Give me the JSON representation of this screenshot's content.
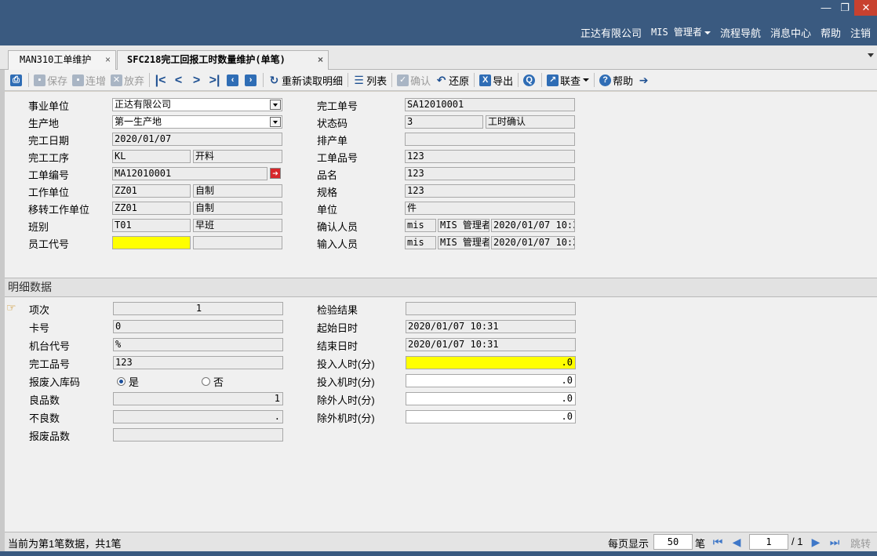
{
  "window": {
    "minimize": "—",
    "restore": "❐",
    "close": "✕"
  },
  "top_menu": {
    "company": "正达有限公司",
    "user": "MIS 管理者",
    "flow_nav": "流程导航",
    "message_center": "消息中心",
    "help": "帮助",
    "logout": "注销"
  },
  "tabs": [
    {
      "label": "MAN310工单维护",
      "close": "×"
    },
    {
      "label": "SFC218完工回报工时数量维护(单笔)",
      "close": "×"
    }
  ],
  "toolbar": {
    "save": "保存",
    "continue_add": "连增",
    "discard": "放弃",
    "reload_detail": "重新读取明细",
    "list": "列表",
    "confirm": "确认",
    "restore": "还原",
    "export": "导出",
    "link_query": "联查",
    "help": "帮助"
  },
  "header": {
    "business_unit": {
      "label": "事业单位",
      "value": "正达有限公司"
    },
    "production_site": {
      "label": "生产地",
      "value": "第一生产地"
    },
    "completion_date": {
      "label": "完工日期",
      "value": "2020/01/07"
    },
    "completion_process": {
      "label": "完工工序",
      "code": "KL",
      "name": "开料"
    },
    "work_order_no": {
      "label": "工单编号",
      "value": "MA12010001"
    },
    "work_unit": {
      "label": "工作单位",
      "code": "ZZ01",
      "name": "自制"
    },
    "transfer_work_unit": {
      "label": "移转工作单位",
      "code": "ZZ01",
      "name": "自制"
    },
    "shift": {
      "label": "班别",
      "code": "T01",
      "name": "早班"
    },
    "employee_code": {
      "label": "员工代号",
      "value": "",
      "name": ""
    },
    "completion_no": {
      "label": "完工单号",
      "value": "SA12010001"
    },
    "status_code": {
      "label": "状态码",
      "code": "3",
      "name": "工时确认"
    },
    "schedule_no": {
      "label": "排产单",
      "value": ""
    },
    "work_order_item": {
      "label": "工单品号",
      "value": "123"
    },
    "item_name": {
      "label": "品名",
      "value": "123"
    },
    "spec": {
      "label": "规格",
      "value": "123"
    },
    "unit": {
      "label": "单位",
      "value": "件"
    },
    "confirmer": {
      "label": "确认人员",
      "code": "mis",
      "name": "MIS 管理者",
      "time": "2020/01/07 10:3"
    },
    "inputter": {
      "label": "输入人员",
      "code": "mis",
      "name": "MIS 管理者",
      "time": "2020/01/07 10:2"
    }
  },
  "detail": {
    "section_title": "明细数据",
    "item_seq": {
      "label": "项次",
      "value": "1"
    },
    "card_no": {
      "label": "卡号",
      "value": "0"
    },
    "machine_code": {
      "label": "机台代号",
      "value": "%"
    },
    "finished_item": {
      "label": "完工品号",
      "value": "123"
    },
    "scrap_stock_code": {
      "label": "报废入库码",
      "yes": "是",
      "no": "否",
      "selected": "是"
    },
    "good_qty": {
      "label": "良品数",
      "value": "1"
    },
    "defect_qty": {
      "label": "不良数",
      "value": "."
    },
    "scrap_qty": {
      "label": "报废品数",
      "value": ""
    },
    "inspection_result": {
      "label": "检验结果",
      "value": ""
    },
    "start_time": {
      "label": "起始日时",
      "value": "2020/01/07 10:31"
    },
    "end_time": {
      "label": "结束日时",
      "value": "2020/01/07 10:31"
    },
    "labor_minutes": {
      "label": "投入人时(分)",
      "value": ".0"
    },
    "machine_minutes": {
      "label": "投入机时(分)",
      "value": ".0"
    },
    "excluded_labor": {
      "label": "除外人时(分)",
      "value": ".0"
    },
    "excluded_machine": {
      "label": "除外机时(分)",
      "value": ".0"
    }
  },
  "status_bar": {
    "record_info": "当前为第1笔数据，共1笔",
    "per_page_label": "每页显示",
    "per_page": "50",
    "per_page_unit": "笔",
    "current_page": "1",
    "total_pages": "/ 1",
    "jump": "跳转"
  },
  "colors": {
    "title_bar": "#3a5a80",
    "required_field": "#ffff00",
    "close_button": "#c8412f"
  }
}
